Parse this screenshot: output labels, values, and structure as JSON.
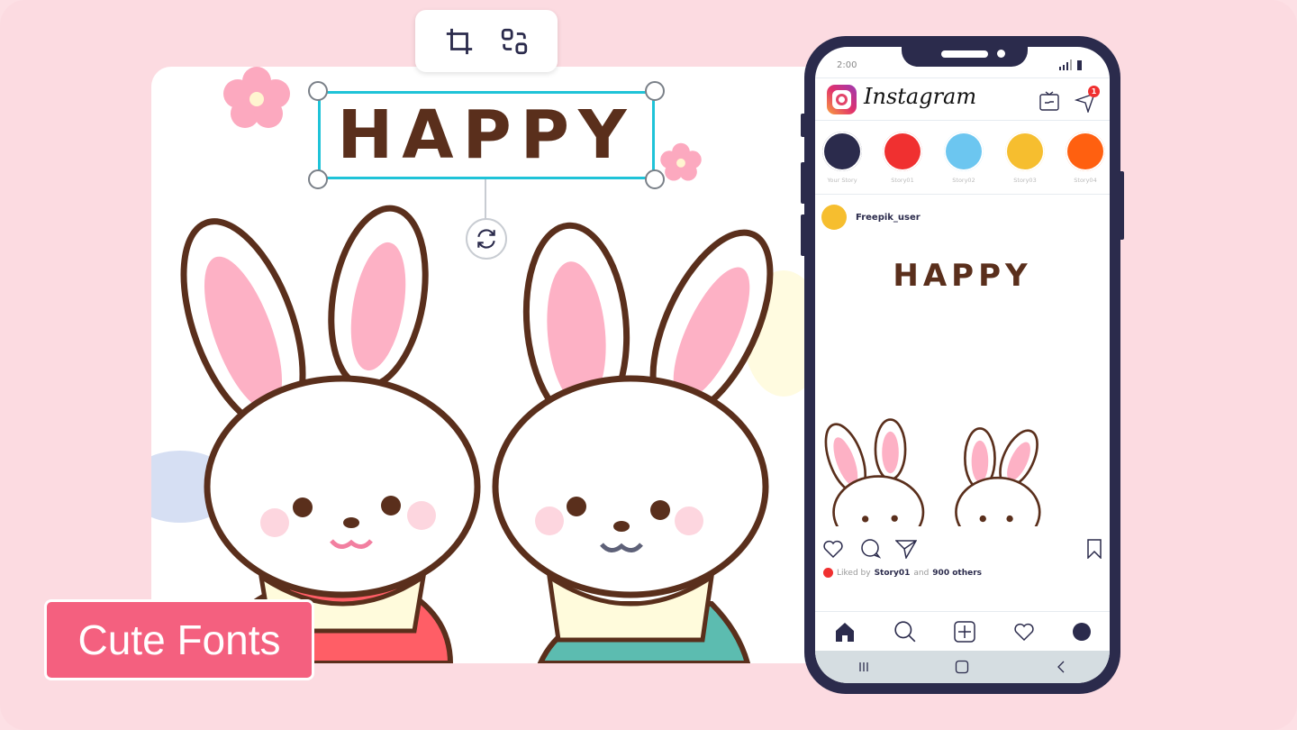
{
  "editor": {
    "text": "HAPPY",
    "tools": [
      "crop-icon",
      "swap-icon"
    ],
    "rotate": "rotate-icon"
  },
  "badge": {
    "label": "Cute Fonts",
    "color": "#f4607f"
  },
  "phone": {
    "time": "2:00",
    "app_name": "Instagram",
    "notification_count": "1",
    "stories": [
      {
        "label": "Your Story",
        "color": "#2b2b4c"
      },
      {
        "label": "Story01",
        "color": "#f03030"
      },
      {
        "label": "Story02",
        "color": "#6cc6f0"
      },
      {
        "label": "Story03",
        "color": "#f6be2f"
      },
      {
        "label": "Story04",
        "color": "#ff6010"
      }
    ],
    "post": {
      "user": "Freepik_user",
      "text": "HAPPY"
    },
    "likes": {
      "prefix": "Liked by",
      "user": "Story01",
      "and": "and",
      "others": "900 others"
    }
  }
}
